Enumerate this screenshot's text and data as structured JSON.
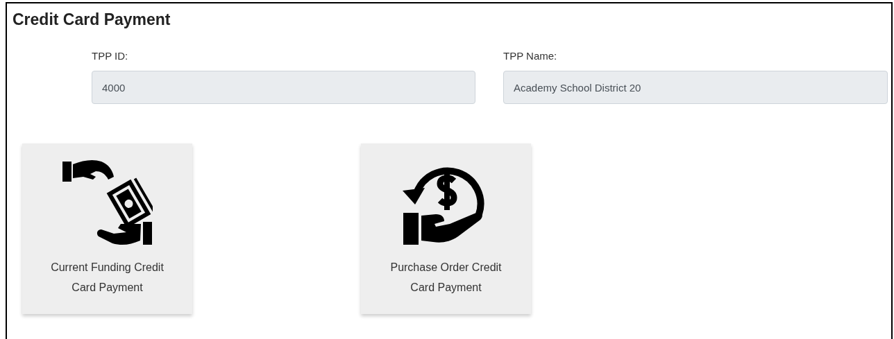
{
  "title": "Credit Card Payment",
  "fields": [
    {
      "label": "TPP ID:",
      "value": "4000"
    },
    {
      "label": "TPP Name:",
      "value": "Academy School District 20"
    }
  ],
  "options": [
    {
      "kind": "funding",
      "label": "Current Funding Credit Card Payment"
    },
    {
      "kind": "purchase_order",
      "label": "Purchase Order Credit Card Payment"
    }
  ]
}
